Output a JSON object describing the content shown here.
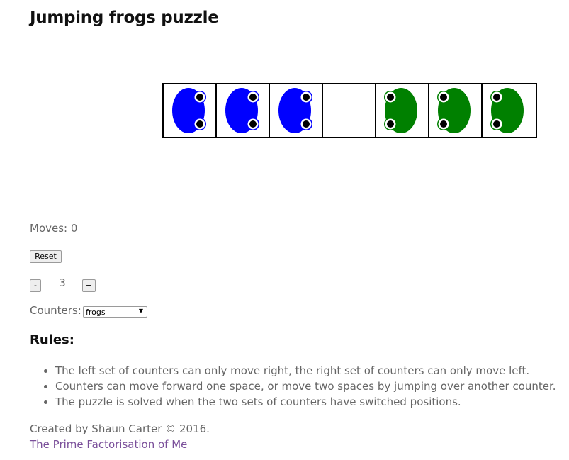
{
  "page": {
    "title": "Jumping frogs puzzle"
  },
  "board": {
    "cells": [
      "blue",
      "blue",
      "blue",
      "empty",
      "green",
      "green",
      "green"
    ],
    "colors": {
      "blue": "#0000ff",
      "green": "#008000"
    }
  },
  "status": {
    "moves_label": "Moves: 0"
  },
  "controls": {
    "reset_label": "Reset",
    "decrement_label": "-",
    "increment_label": "+",
    "count_value": "3",
    "counters_label": "Counters:",
    "counters_selected": "frogs"
  },
  "rules": {
    "heading": "Rules:",
    "items": [
      "The left set of counters can only move right, the right set of counters can only move left.",
      "Counters can move forward one space, or move two spaces by jumping over another counter.",
      "The puzzle is solved when the two sets of counters have switched positions."
    ]
  },
  "footer": {
    "credit": "Created by Shaun Carter © 2016.",
    "link_text": "The Prime Factorisation of Me"
  }
}
